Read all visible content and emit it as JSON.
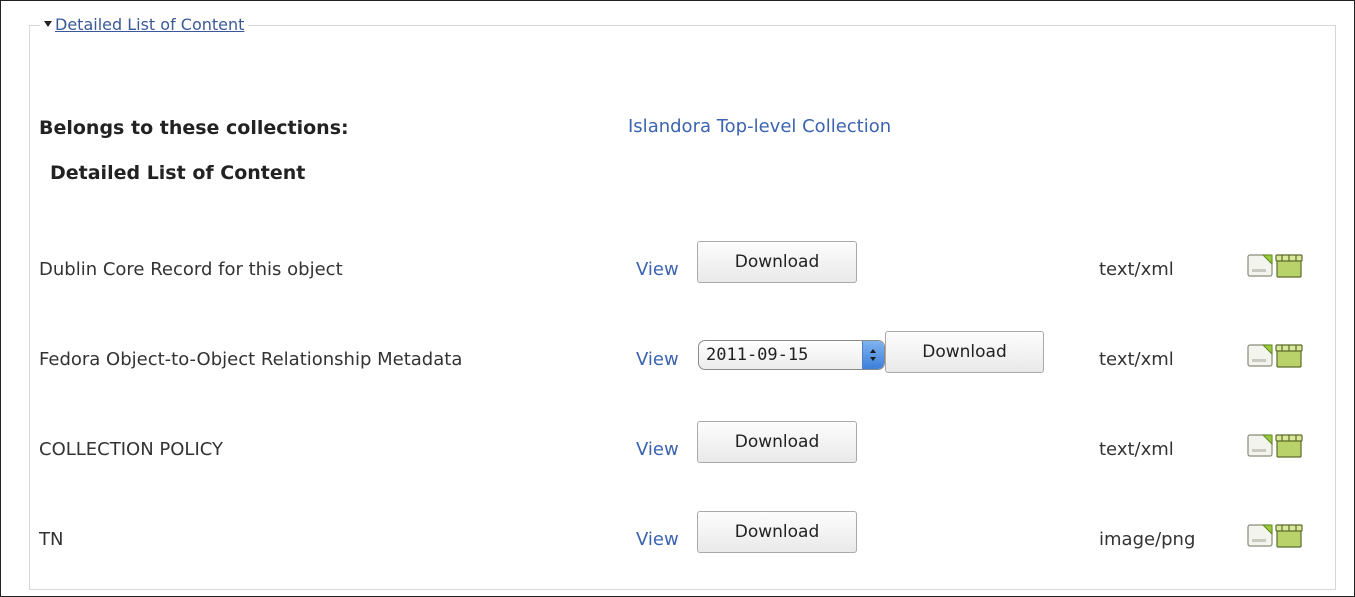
{
  "panel": {
    "legend_label": "Detailed List of Content"
  },
  "collections": {
    "label": "Belongs to these collections:",
    "link": "Islandora Top-level Collection"
  },
  "section_title": "Detailed List of Content",
  "datastreams": [
    {
      "name": "Dublin Core Record for this object",
      "view": "View",
      "download": "Download",
      "mime": "text/xml"
    },
    {
      "name": "Fedora Object-to-Object Relationship Metadata",
      "view": "View",
      "version": "2011-09-15",
      "download": "Download",
      "mime": "text/xml"
    },
    {
      "name": "COLLECTION POLICY",
      "view": "View",
      "download": "Download",
      "mime": "text/xml"
    },
    {
      "name": "TN",
      "view": "View",
      "download": "Download",
      "mime": "image/png"
    }
  ],
  "icons": {
    "file": "file-icon",
    "archive": "archive-box-icon"
  },
  "colors": {
    "link": "#3b63b0",
    "select_arrows": "#3c7fdb",
    "icon_green": "#8fbf3a"
  }
}
